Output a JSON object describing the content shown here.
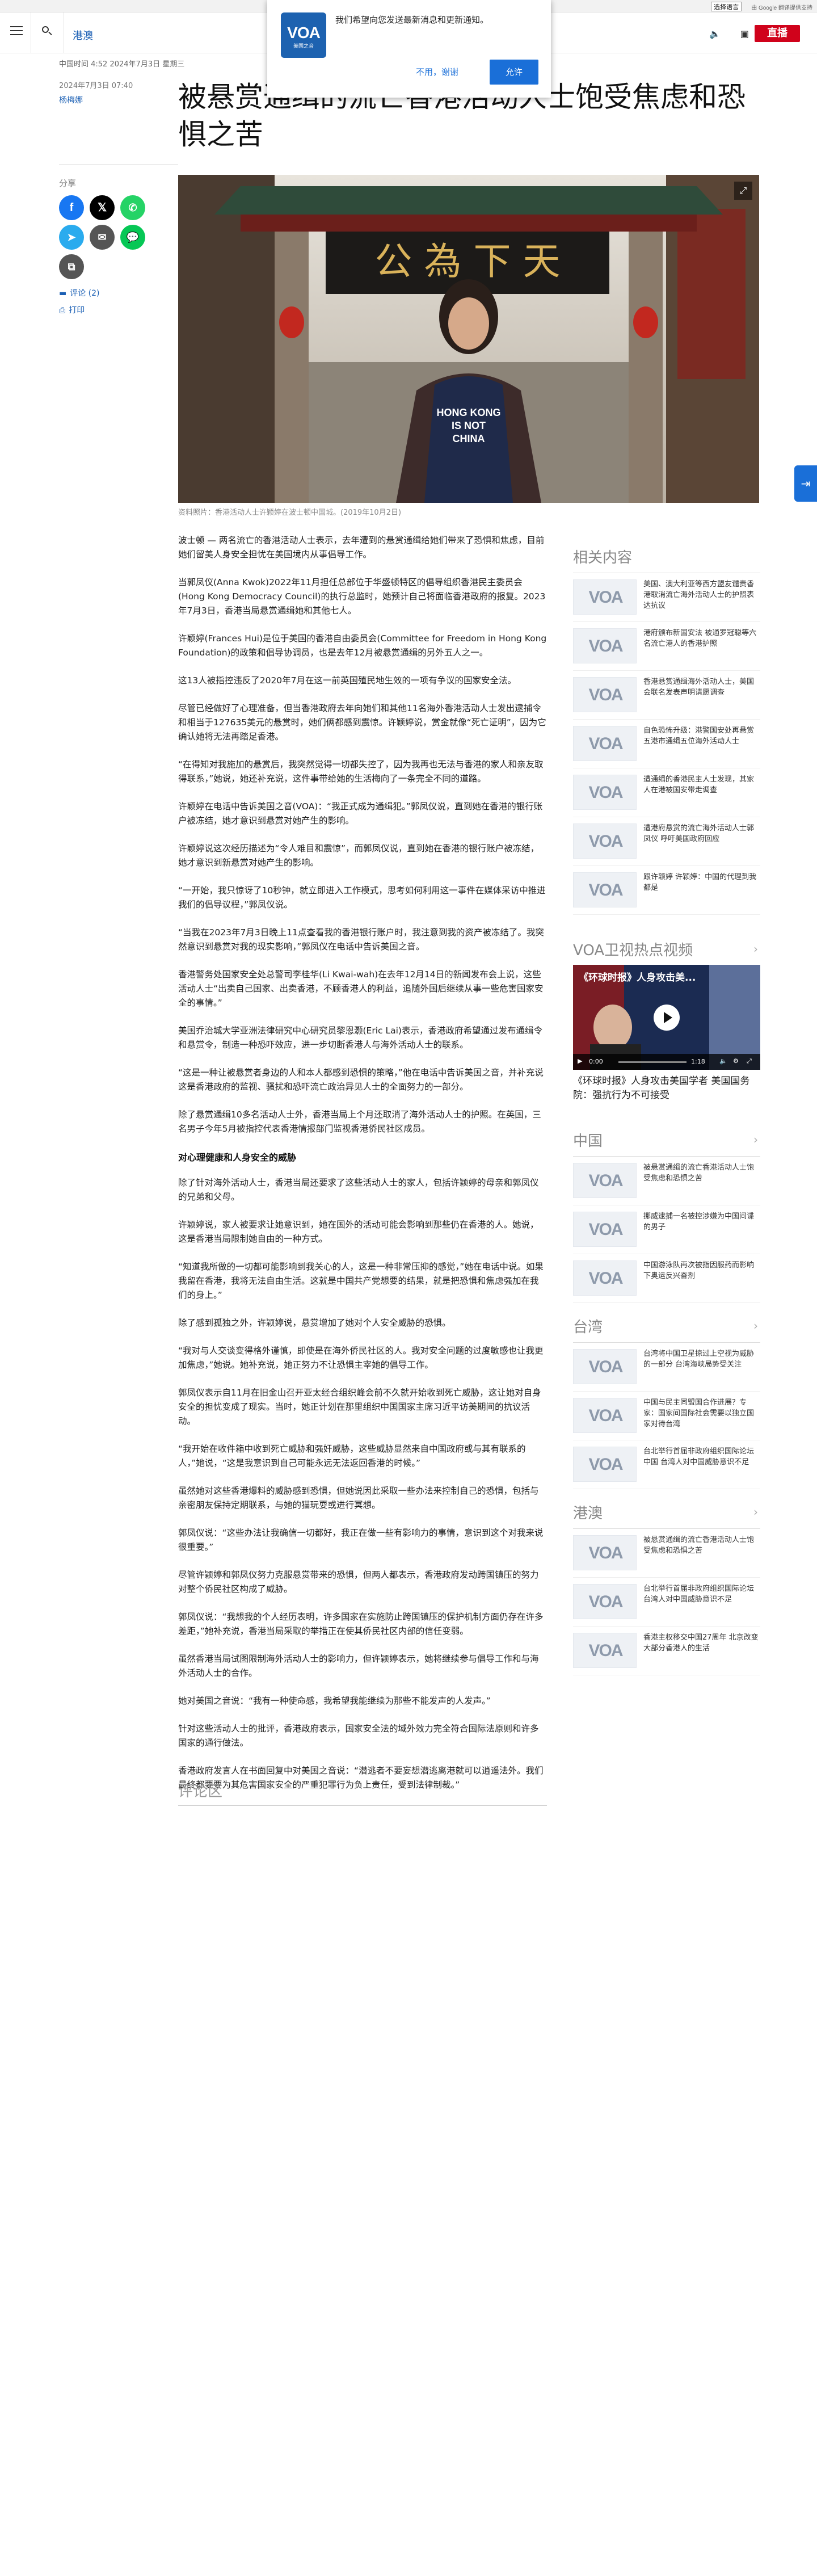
{
  "topbar": {
    "language_select": "选择语言",
    "google_translate": "由 Google 翻译提供支持"
  },
  "header": {
    "section": "港澳",
    "live_label": "直播"
  },
  "notification": {
    "message": "我们希望向您发送最新消息和更新通知。",
    "deny": "不用，谢谢",
    "allow": "允许",
    "logo_text": "VOA",
    "logo_sub": "美国之音"
  },
  "meta": {
    "timestamp": "中国时间 4:52 2024年7月3日 星期三",
    "date": "2024年7月3日 07:40",
    "author": "杨梅娜",
    "share_label": "分享",
    "comments_link": "评论 (2)",
    "print_link": "打印"
  },
  "article": {
    "title": "被悬赏通缉的流亡香港活动人士饱受焦虑和恐惧之苦",
    "image_caption": "资料照片：香港活动人士许颖婷在波士顿中国城。(2019年10月2日)",
    "hero_sign": "公 為 下 天",
    "hero_shirt": [
      "HONG KONG",
      "IS NOT",
      "CHINA"
    ],
    "paragraphs": [
      "波士顿 — 两名流亡的香港活动人士表示，去年遭到的悬赏通缉给她们带来了恐惧和焦虑，目前她们留美人身安全担忧在美国境内从事倡导工作。",
      "当郭凤仪(Anna Kwok)2022年11月担任总部位于华盛顿特区的倡导组织香港民主委员会(Hong Kong Democracy Council)的执行总监时，她预计自己将面临香港政府的报复。2023年7月3日，香港当局悬赏通缉她和其他七人。",
      "许颖婷(Frances Hui)是位于美国的香港自由委员会(Committee for Freedom in Hong Kong Foundation)的政策和倡导协调员，也是去年12月被悬赏通缉的另外五人之一。",
      "这13人被指控违反了2020年7月在这一前英国殖民地生效的一项有争议的国家安全法。",
      "尽管已经做好了心理准备，但当香港政府去年向她们和其他11名海外香港活动人士发出逮捕令和相当于127635美元的悬赏时，她们俩都感到震惊。许颖婷说，赏金就像“死亡证明”，因为它确认她将无法再踏足香港。",
      "“在得知对我施加的悬赏后，我突然觉得一切都失控了，因为我再也无法与香港的家人和亲友取得联系，”她说，她还补充说，这件事带给她的生活梅向了一条完全不同的道路。",
      "许颖婷在电话中告诉美国之音(VOA)：“我正式成为通缉犯。”郭凤仪说，直到她在香港的银行账户被冻结，她才意识到悬赏对她产生的影响。",
      "许颖婷说这次经历描述为“令人难目和震惊”，而郭凤仪说，直到她在香港的银行账户被冻结，她才意识到新悬赏对她产生的影响。",
      "“一开始，我只惊讶了10秒钟，就立即进入工作模式，思考如何利用这一事件在媒体采访中推进我们的倡导议程，”郭凤仪说。",
      "“当我在2023年7月3日晚上11点查看我的香港银行账户时，我注意到我的资产被冻结了。我突然意识到悬赏对我的现实影响，”郭凤仪在电话中告诉美国之音。",
      "香港警务处国家安全处总警司李桂华(Li Kwai-wah)在去年12月14日的新闻发布会上说，这些活动人士“出卖自己国家、出卖香港，不顾香港人的利益，追随外国后继续从事一些危害国家安全的事情。”",
      "美国乔治城大学亚洲法律研究中心研究员黎恩灏(Eric Lai)表示，香港政府希望通过发布通缉令和悬赏令，制造一种恐吓效应，进一步切断香港人与海外活动人士的联系。",
      "“这是一种让被悬赏者身边的人和本人都感到恐惧的策略，”他在电话中告诉美国之音，并补充说这是香港政府的监视、骚扰和恐吓流亡政治异见人士的全面努力的一部分。",
      "除了悬赏通缉10多名活动人士外，香港当局上个月还取消了海外活动人士的护照。在英国，三名男子今年5月被指控代表香港情报部门监视香港侨民社区成员。",
      "除了针对海外活动人士，香港当局还要求了这些活动人士的家人，包括许颖婷的母亲和郭凤仪的兄弟和父母。",
      "许颖婷说，家人被要求让她意识到，她在国外的活动可能会影响到那些仍在香港的人。她说，这是香港当局限制她自由的一种方式。",
      "“知道我所做的一切都可能影响到我关心的人，这是一种非常压抑的感觉，”她在电话中说。如果我留在香港，我将无法自由生活。这就是中国共产党想要的结果，就是把恐惧和焦虑强加在我们的身上。”",
      "除了感到孤独之外，许颖婷说，悬赏增加了她对个人安全威胁的恐惧。",
      "“我对与人交谈变得格外谨慎，即使是在海外侨民社区的人。我对安全问题的过度敏感也让我更加焦虑，”她说。她补充说，她正努力不让恐惧主宰她的倡导工作。",
      "郭凤仪表示自11月在旧金山召开亚太经合组织峰会前不久就开始收到死亡威胁，这让她对自身安全的担忧变成了现实。当时，她正计划在那里组织中国国家主席习近平访美期间的抗议活动。",
      "“我开始在收件箱中收到死亡威胁和强奸威胁，这些威胁显然来自中国政府或与其有联系的人，”她说，“这是我意识到自己可能永远无法返回香港的时候。”",
      "虽然她对这些香港爆料的威胁感到恐惧，但她说因此采取一些办法来控制自己的恐惧，包括与亲密朋友保持定期联系，与她的猫玩耍或进行冥想。",
      "郭凤仪说：“这些办法让我确信一切都好，我正在做一些有影响力的事情，意识到这个对我来说很重要。”",
      "尽管许颖婷和郭凤仪努力克服悬赏带来的恐惧，但两人都表示，香港政府发动跨国镇压的努力对整个侨民社区构成了威胁。",
      "郭凤仪说：“我想我的个人经历表明，许多国家在实施防止跨国镇压的保护机制方面仍存在许多差距，”她补充说，香港当局采取的举措正在使其侨民社区内部的信任变弱。",
      "虽然香港当局试图限制海外活动人士的影响力，但许颖婷表示，她将继续参与倡导工作和与海外活动人士的合作。",
      "她对美国之音说：“我有一种使命感，我希望我能继续为那些不能发声的人发声。”",
      "针对这些活动人士的批评，香港政府表示，国家安全法的域外效力完全符合国际法原则和许多国家的通行做法。",
      "香港政府发言人在书面回复中对美国之音说：“潜逃者不要妄想潜逃离港就可以逍遥法外。我们最终都要要为其危害国家安全的严重犯罪行为负上责任，受到法律制裁。”"
    ],
    "subheading": "对心理健康和人身安全的威胁",
    "subheading_after": 13,
    "comments_title": "评论区"
  },
  "rail": {
    "related_title": "相关内容",
    "related": [
      "美国、澳大利亚等西方盟友谴责香港取消流亡海外活动人士的护照表达抗议",
      "港府颁布新国安法 被通罗冠聪等六名流亡港人的香港护照",
      "香港悬赏通缉海外活动人士，美国会联名发表声明请愿调查",
      "自色恐怖升级：港警国安处再悬赏五港市通缉五位海外活动人士",
      "遭通缉的香港民主人士发现，其家人在港被国安带走调查",
      "遭港府悬赏的流亡海外活动人士郭凤仪 呼吁美国政府回应",
      "跟许颖婷 许颖婷：中国的代理到我都是"
    ],
    "video_section_title": "VOA卫视热点视频",
    "video_overlay": "《环球时报》人身攻击美...",
    "video_time": "0:00",
    "video_duration": "1:18",
    "video_caption": "《环球时报》人身攻击美国学者 美国国务院：强抗行为不可接受",
    "china_title": "中国",
    "china": [
      "被悬赏通缉的流亡香港活动人士饱受焦虑和恐惧之苦",
      "挪威逮捕一名被控涉嫌为中国间谍的男子",
      "中国游泳队再次被指因服药而影响下奥运反兴奋剂"
    ],
    "taiwan_title": "台湾",
    "taiwan": [
      "台湾将中国卫星掠过上空视为威胁的一部分 台湾海峡局势受关注",
      "中国与民主同盟国合作进展？专家：国家间国际社会需要以独立国家对待台湾",
      "台北举行首届非政府组织国际论坛中国 台湾人对中国威胁意识不足"
    ],
    "hk_title": "港澳",
    "hk": [
      "被悬赏通缉的流亡香港活动人士饱受焦虑和恐惧之苦",
      "台北举行首届非政府组织国际论坛 台湾人对中国威胁意识不足",
      "香港主权移交中国27周年 北京改变大部分香港人的生活"
    ]
  }
}
